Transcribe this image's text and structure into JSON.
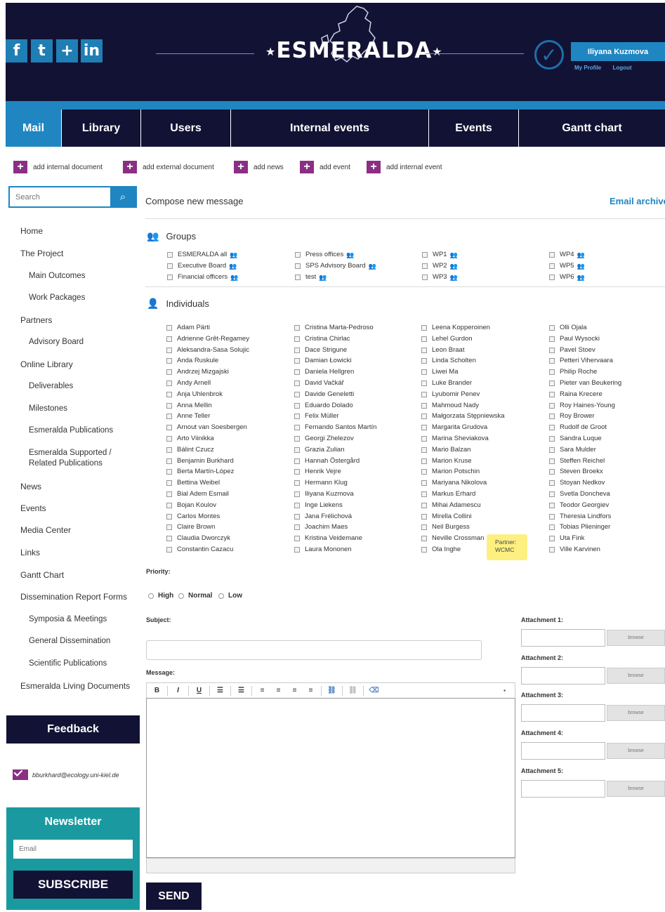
{
  "header": {
    "logo_text": "ESMERALDA",
    "social": [
      {
        "icon": "facebook-icon",
        "glyph": "f"
      },
      {
        "icon": "twitter-icon",
        "glyph": "t"
      },
      {
        "icon": "google-plus-icon",
        "glyph": "+"
      },
      {
        "icon": "linkedin-icon",
        "glyph": "in"
      }
    ],
    "user_name": "Iliyana Kuzmova",
    "my_profile": "My Profile",
    "logout": "Logout"
  },
  "nav": {
    "tabs": [
      "Mail",
      "Library",
      "Users",
      "Internal events",
      "Events",
      "Gantt chart"
    ],
    "active": "Mail"
  },
  "actions": [
    "add internal document",
    "add external document",
    "add news",
    "add event",
    "add internal event"
  ],
  "sidebar": {
    "search_placeholder": "Search",
    "items": [
      {
        "label": "Home",
        "sub": false
      },
      {
        "label": "The Project",
        "sub": false
      },
      {
        "label": "Main Outcomes",
        "sub": true
      },
      {
        "label": "Work Packages",
        "sub": true
      },
      {
        "label": "Partners",
        "sub": false
      },
      {
        "label": "Advisory Board",
        "sub": true
      },
      {
        "label": "Online Library",
        "sub": false
      },
      {
        "label": "Deliverables",
        "sub": true
      },
      {
        "label": "Milestones",
        "sub": true
      },
      {
        "label": "Esmeralda Publications",
        "sub": true
      },
      {
        "label": "Esmeralda Supported / Related Publications",
        "sub": true
      },
      {
        "label": "News",
        "sub": false
      },
      {
        "label": "Events",
        "sub": false
      },
      {
        "label": "Media Center",
        "sub": false
      },
      {
        "label": "Links",
        "sub": false
      },
      {
        "label": "Gantt Chart",
        "sub": false
      },
      {
        "label": "Dissemination Report Forms",
        "sub": false
      },
      {
        "label": "Symposia & Meetings",
        "sub": true
      },
      {
        "label": "General Dissemination",
        "sub": true
      },
      {
        "label": "Scientific Publications",
        "sub": true
      },
      {
        "label": "Esmeralda Living Documents",
        "sub": false
      }
    ],
    "feedback": "Feedback",
    "contact_email": "bburkhard@ecology.uni-kiel.de",
    "newsletter_title": "Newsletter",
    "newsletter_placeholder": "Email",
    "subscribe": "SUBSCRIBE"
  },
  "main": {
    "compose_title": "Compose new message",
    "email_archive": "Email archive",
    "groups_title": "Groups",
    "groups": [
      [
        "ESMERALDA all",
        "Executive Board",
        "Financial officers"
      ],
      [
        "Press offices",
        "SPS Advisory Board",
        "test"
      ],
      [
        "WP1",
        "WP2",
        "WP3"
      ],
      [
        "WP4",
        "WP5",
        "WP6"
      ]
    ],
    "individuals_title": "Individuals",
    "individuals": [
      [
        "Adam Pärti",
        "Adrienne Grêt-Regamey",
        "Aleksandra-Sasa Solujic",
        "Anda Ruskule",
        "Andrzej Mizgajski",
        "Andy Arnell",
        "Anja Uhlenbrok",
        "Anna Mellin",
        "Anne Teller",
        "Arnout van Soesbergen",
        "Arto Viinikka",
        "Bálint Czucz",
        "Benjamin Burkhard",
        "Berta Martín-López",
        "Bettina Weibel",
        "Bial Adem Esmail",
        "Bojan Koulov",
        "Carlos Montes",
        "Claire Brown",
        "Claudia Dworczyk",
        "Constantin Cazacu"
      ],
      [
        "Cristina Marta-Pedroso",
        "Cristina Chirlac",
        "Dace Strigune",
        "Damian Łowicki",
        "Daniela Hellgren",
        "David Vačkář",
        "Davide Geneletti",
        "Eduardo Dolado",
        "Felix Müller",
        "Fernando Santos Martín",
        "Georgi Zhelezov",
        "Grazia Zulian",
        "Hannah Östergård",
        "Henrik Vejre",
        "Hermann Klug",
        "Iliyana Kuzmova",
        "Inge Liekens",
        "Jana Frélichová",
        "Joachim Maes",
        "Kristina Veidemane",
        "Laura Mononen"
      ],
      [
        "Leena Kopperoinen",
        "Lehel Gurdon",
        "Leon Braat",
        "Linda Scholten",
        "Liwei Ma",
        "Luke Brander",
        "Lyubomir Penev",
        "Mahmoud Nady",
        "Małgorzata Stępniewska",
        "Margarita Grudova",
        "Marina Sheviakova",
        "Mario Balzan",
        "Marion Kruse",
        "Marion Potschin",
        "Mariyana Nikolova",
        "Markus Erhard",
        "Mihai Adamescu",
        "Mirella Collini",
        "Neil Burgess",
        "Neville Crossman",
        "Ola Inghe"
      ],
      [
        "Olli Ojala",
        "Paul Wysocki",
        "Pavel Stoev",
        "Petteri Vihervaara",
        "Philip Roche",
        "Pieter van Beukering",
        "Raina Krecere",
        "Roy Haines-Young",
        "Roy Brower",
        "Rudolf de Groot",
        "Sandra Luque",
        "Sara Mulder",
        "Steffen Reichel",
        "Steven Broekx",
        "Stoyan Nedkov",
        "Svetla Doncheva",
        "Teodor Georgiev",
        "Theresia Lindfors",
        "Tobias Plieninger",
        "Uta Fink",
        "Ville Karvinen"
      ]
    ],
    "tooltip_line1": "Partner:",
    "tooltip_line2": "WCMC",
    "priority_label": "Priority:",
    "priority_options": [
      "High",
      "Normal",
      "Low"
    ],
    "subject_label": "Subject:",
    "message_label": "Message:",
    "send": "SEND",
    "attachments": [
      "Attachment 1:",
      "Attachment 2:",
      "Attachment 3:",
      "Attachment 4:",
      "Attachment 5:"
    ],
    "browse": "browse"
  }
}
